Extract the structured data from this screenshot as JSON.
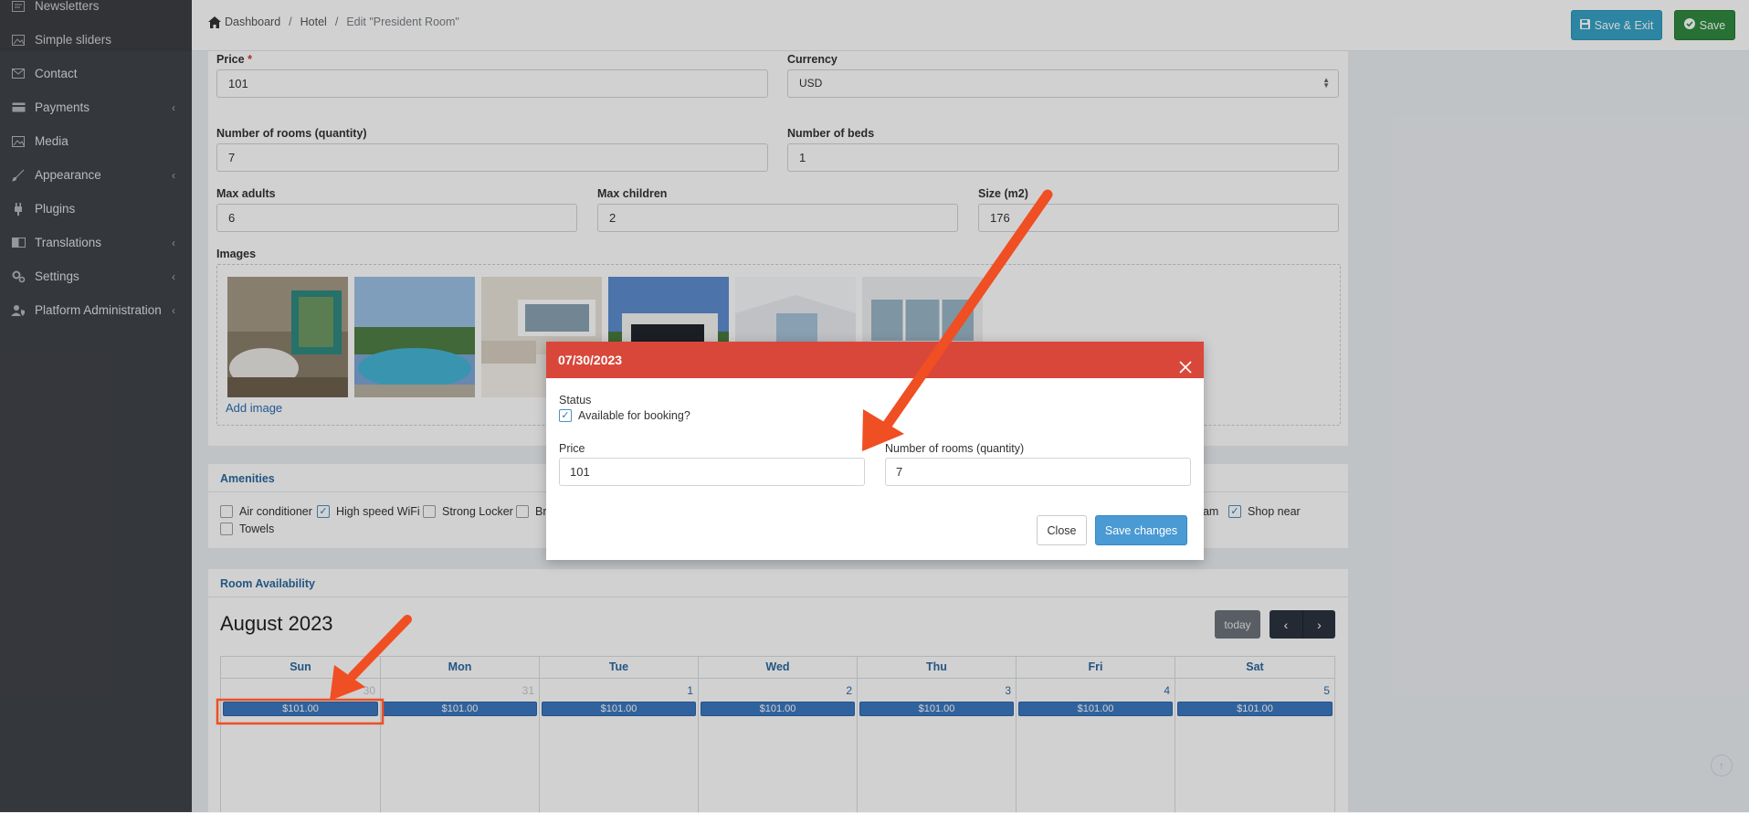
{
  "sidebar": {
    "items": [
      {
        "label": "Newsletters",
        "icon": "newsletter-icon",
        "has_children": false
      },
      {
        "label": "Simple sliders",
        "icon": "image-icon",
        "has_children": false
      },
      {
        "label": "Contact",
        "icon": "envelope-icon",
        "has_children": false
      },
      {
        "label": "Payments",
        "icon": "credit-card-icon",
        "has_children": true
      },
      {
        "label": "Media",
        "icon": "image-icon",
        "has_children": false
      },
      {
        "label": "Appearance",
        "icon": "brush-icon",
        "has_children": true
      },
      {
        "label": "Plugins",
        "icon": "plug-icon",
        "has_children": false
      },
      {
        "label": "Translations",
        "icon": "language-icon",
        "has_children": true
      },
      {
        "label": "Settings",
        "icon": "gears-icon",
        "has_children": true
      },
      {
        "label": "Platform Administration",
        "icon": "user-shield-icon",
        "has_children": true
      }
    ]
  },
  "header": {
    "breadcrumb": [
      "Dashboard",
      "Hotel",
      "Edit \"President Room\""
    ],
    "save_exit_label": "Save & Exit",
    "save_label": "Save"
  },
  "form": {
    "price_label": "Price",
    "price_required": "*",
    "price_value": "101",
    "currency_label": "Currency",
    "currency_value": "USD",
    "rooms_label": "Number of rooms (quantity)",
    "rooms_value": "7",
    "beds_label": "Number of beds",
    "beds_value": "1",
    "max_adults_label": "Max adults",
    "max_adults_value": "6",
    "max_children_label": "Max children",
    "max_children_value": "2",
    "size_label": "Size (m2)",
    "size_value": "176",
    "images_label": "Images",
    "add_image_label": "Add image"
  },
  "amenities": {
    "title": "Amenities",
    "items": [
      {
        "label": "Air conditioner",
        "checked": false
      },
      {
        "label": "High speed WiFi",
        "checked": true
      },
      {
        "label": "Strong Locker",
        "checked": false
      },
      {
        "label": "Br",
        "checked": false
      },
      {
        "label": "eam",
        "checked": true
      },
      {
        "label": "Shop near",
        "checked": false
      },
      {
        "label": "Towels",
        "checked": false
      }
    ]
  },
  "availability": {
    "title": "Room Availability",
    "month_title": "August 2023",
    "today_label": "today",
    "days": [
      {
        "head": "Sun",
        "num": "30",
        "other": true,
        "price": "$101.00"
      },
      {
        "head": "Mon",
        "num": "31",
        "other": true,
        "price": "$101.00"
      },
      {
        "head": "Tue",
        "num": "1",
        "other": false,
        "price": "$101.00"
      },
      {
        "head": "Wed",
        "num": "2",
        "other": false,
        "price": "$101.00"
      },
      {
        "head": "Thu",
        "num": "3",
        "other": false,
        "price": "$101.00"
      },
      {
        "head": "Fri",
        "num": "4",
        "other": false,
        "price": "$101.00"
      },
      {
        "head": "Sat",
        "num": "5",
        "other": false,
        "price": "$101.00"
      }
    ]
  },
  "modal": {
    "title": "07/30/2023",
    "status_label": "Status",
    "available_label": "Available for booking?",
    "available_checked": true,
    "price_label": "Price",
    "price_value": "101",
    "rooms_label": "Number of rooms (quantity)",
    "rooms_value": "7",
    "close_label": "Close",
    "save_label": "Save changes"
  },
  "colors": {
    "modal_header": "#d9473a",
    "annotation_arrow": "#f04e23",
    "event_blue": "#3b78c0"
  }
}
